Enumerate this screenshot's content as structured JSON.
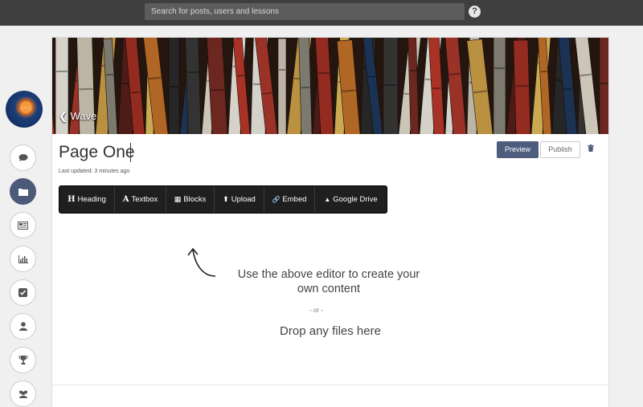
{
  "topbar": {
    "search_placeholder": "Search for posts, users and lessons",
    "help_glyph": "?"
  },
  "sidebar": {
    "items": [
      {
        "name": "comment-icon",
        "glyph": "💬"
      },
      {
        "name": "folder-icon",
        "glyph": "📁",
        "active": true
      },
      {
        "name": "newspaper-icon",
        "glyph": "📰"
      },
      {
        "name": "bar-chart-icon",
        "glyph": "📊"
      },
      {
        "name": "checkbox-icon",
        "glyph": "☑"
      },
      {
        "name": "user-icon",
        "glyph": "👤"
      },
      {
        "name": "trophy-icon",
        "glyph": "🏆"
      },
      {
        "name": "group-icon",
        "glyph": "👥"
      }
    ]
  },
  "banner": {
    "back_label": "Wave"
  },
  "page": {
    "title": "Page One",
    "updated": "Last updated: 3 minutes ago",
    "preview_label": "Preview",
    "publish_label": "Publish"
  },
  "toolbar": {
    "tools": [
      {
        "icon": "H",
        "label": "Heading"
      },
      {
        "icon": "A",
        "label": "Textbox"
      },
      {
        "icon": "▦",
        "label": "Blocks"
      },
      {
        "icon": "⬆",
        "label": "Upload"
      },
      {
        "icon": "🔗",
        "label": "Embed"
      },
      {
        "icon": "▲",
        "label": "Google Drive"
      }
    ]
  },
  "editor": {
    "hint_line1": "Use the above editor to create your",
    "hint_line2": "own content",
    "or_label": "- or -",
    "drop_label": "Drop any files here"
  },
  "colors": {
    "topbar": "#3f3f3f",
    "accent": "#4e5d7d",
    "toolbar": "#1f1f1f"
  }
}
